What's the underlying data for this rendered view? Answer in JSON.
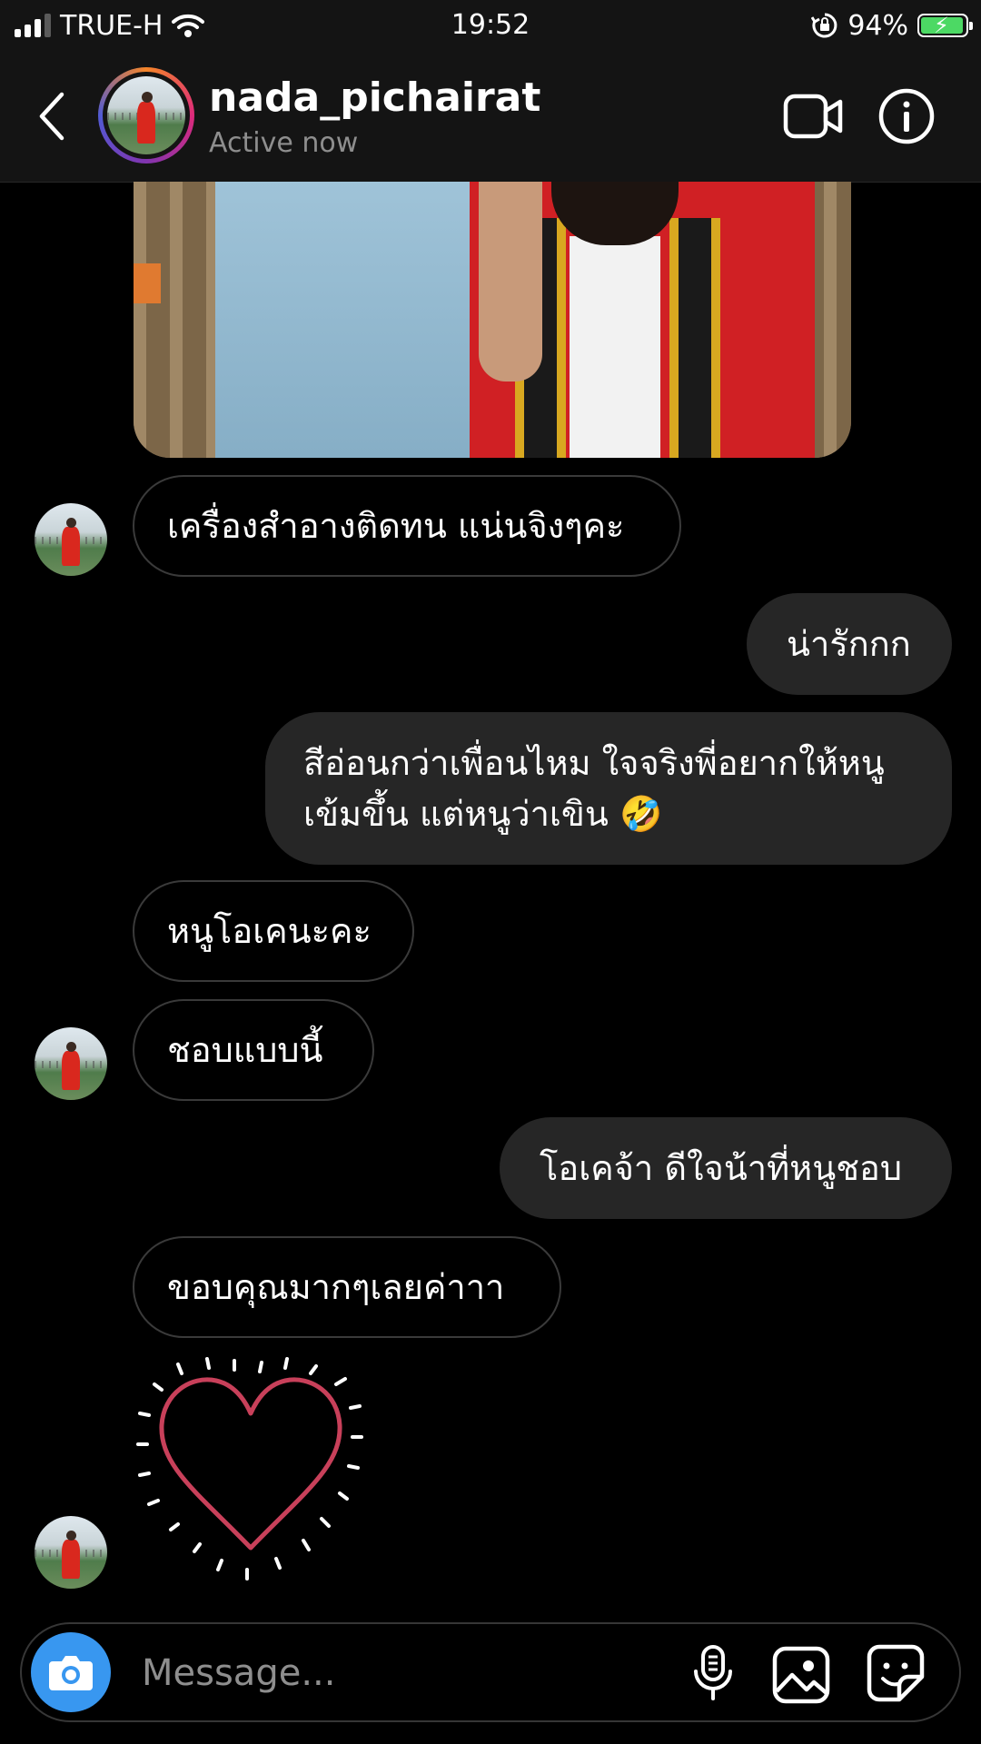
{
  "status_bar": {
    "carrier": "TRUE-H",
    "time": "19:52",
    "battery_percent": "94%",
    "battery_level": 0.94,
    "icons": [
      "signal-icon",
      "wifi-icon",
      "orientation-lock-icon",
      "battery-icon"
    ]
  },
  "header": {
    "username": "nada_pichairat",
    "status": "Active now",
    "icons": [
      "back-icon",
      "avatar",
      "video-call-icon",
      "info-icon"
    ]
  },
  "messages": [
    {
      "side": "incoming",
      "text": "เครื่องสำอางติดทน แน่นจิงๆคะ"
    },
    {
      "side": "outgoing",
      "text": "น่ารักกก"
    },
    {
      "side": "outgoing",
      "line1": "สีอ่อนกว่าเพื่อนไหม ใจจริงพี่อยากให้หนู",
      "line2": "เข้มขึ้น แต่หนูว่าเขิน 🤣"
    },
    {
      "side": "incoming",
      "text": "หนูโอเคนะคะ"
    },
    {
      "side": "incoming",
      "text": "ชอบแบบนี้"
    },
    {
      "side": "outgoing",
      "text": "โอเคจ้า ดีใจน้าที่หนูชอบ"
    },
    {
      "side": "incoming",
      "text": "ขอบคุณมากๆเลยค่าาา"
    },
    {
      "side": "incoming",
      "sticker": "heart-sticker-icon"
    }
  ],
  "composer": {
    "placeholder": "Message...",
    "icons": [
      "camera-icon",
      "microphone-icon",
      "gallery-icon",
      "sticker-icon"
    ]
  },
  "colors": {
    "background": "#000000",
    "header": "#141414",
    "outgoing_bubble": "#262626",
    "incoming_border": "#3a3a3a",
    "camera_button": "#3897f0",
    "heart": "#c8405a",
    "battery_fill": "#4cd964"
  }
}
